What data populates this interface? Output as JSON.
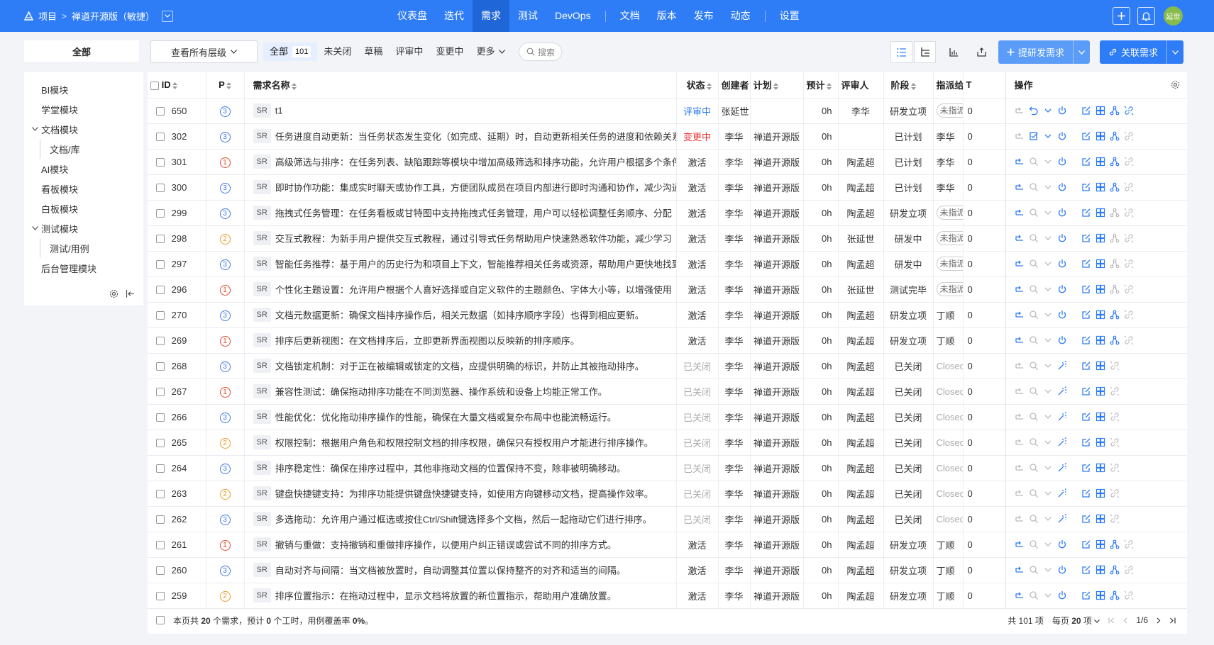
{
  "topbar": {
    "project_label": "项目",
    "project_name": "禅道开源版（敏捷）",
    "nav": [
      "仪表盘",
      "迭代",
      "需求",
      "测试",
      "DevOps",
      "文档",
      "版本",
      "发布",
      "动态",
      "设置"
    ],
    "active_nav": "需求",
    "avatar_text": "延世"
  },
  "filter": {
    "scope_all": "全部",
    "level_select": "查看所有层级",
    "tabs": [
      {
        "label": "全部",
        "count": "101",
        "active": true
      },
      {
        "label": "未关闭"
      },
      {
        "label": "草稿"
      },
      {
        "label": "评审中"
      },
      {
        "label": "变更中"
      },
      {
        "label": "更多"
      }
    ],
    "search_placeholder": "搜索",
    "btn_create": "提研发需求",
    "btn_link": "关联需求"
  },
  "sidebar": {
    "items": [
      {
        "label": "BI模块",
        "level": 0
      },
      {
        "label": "学堂模块",
        "level": 0
      },
      {
        "label": "文档模块",
        "level": 0,
        "expanded": true
      },
      {
        "label": "文档/库",
        "level": 1
      },
      {
        "label": "AI模块",
        "level": 0
      },
      {
        "label": "看板模块",
        "level": 0
      },
      {
        "label": "白板模块",
        "level": 0
      },
      {
        "label": "测试模块",
        "level": 0,
        "expanded": true
      },
      {
        "label": "测试/用例",
        "level": 1
      },
      {
        "label": "后台管理模块",
        "level": 0
      }
    ]
  },
  "table": {
    "columns": {
      "id": "ID",
      "pri": "P",
      "title": "需求名称",
      "status": "状态",
      "creator": "创建者",
      "plan": "计划",
      "estimate": "预计",
      "reviewer": "评审人",
      "stage": "阶段",
      "assigned": "指派给",
      "t": "T",
      "actions": "操作"
    },
    "rows": [
      {
        "id": "650",
        "pri": "3",
        "title": "t1",
        "status": "评审中",
        "status_type": "review",
        "creator": "张延世",
        "plan": "",
        "estimate": "0h",
        "reviewer": "李华",
        "stage": "研发立项",
        "assigned": "未指派",
        "assigned_type": "pill",
        "t": "0",
        "acts": "review"
      },
      {
        "id": "302",
        "pri": "3",
        "title": "任务进度自动更新：当任务状态发生变化（如完成、延期）时，自动更新相关任务的进度和依赖关系",
        "status": "变更中",
        "status_type": "change",
        "creator": "李华",
        "plan": "禅道开源版",
        "estimate": "0h",
        "reviewer": "",
        "stage": "已计划",
        "assigned": "李华",
        "assigned_type": "text",
        "t": "0",
        "acts": "change"
      },
      {
        "id": "301",
        "pri": "1",
        "title": "高级筛选与排序：在任务列表、缺陷跟踪等模块中增加高级筛选和排序功能，允许用户根据多个条件",
        "status": "激活",
        "status_type": "active",
        "creator": "李华",
        "plan": "禅道开源版",
        "estimate": "0h",
        "reviewer": "陶孟超",
        "stage": "已计划",
        "assigned": "李华",
        "assigned_type": "text",
        "t": "0",
        "acts": "active"
      },
      {
        "id": "300",
        "pri": "3",
        "title": "即时协作功能：集成实时聊天或协作工具，方便团队成员在项目内部进行即时沟通和协作，减少沟通",
        "status": "激活",
        "status_type": "active",
        "creator": "李华",
        "plan": "禅道开源版",
        "estimate": "0h",
        "reviewer": "陶孟超",
        "stage": "已计划",
        "assigned": "李华",
        "assigned_type": "text",
        "t": "0",
        "acts": "active"
      },
      {
        "id": "299",
        "pri": "3",
        "title": "拖拽式任务管理：在任务看板或甘特图中支持拖拽式任务管理，用户可以轻松调整任务顺序、分配",
        "status": "激活",
        "status_type": "active",
        "creator": "李华",
        "plan": "禅道开源版",
        "estimate": "0h",
        "reviewer": "陶孟超",
        "stage": "研发立项",
        "assigned": "未指派",
        "assigned_type": "pill",
        "t": "0",
        "acts": "active-dim"
      },
      {
        "id": "298",
        "pri": "2",
        "title": "交互式教程：为新手用户提供交互式教程，通过引导式任务帮助用户快速熟悉软件功能，减少学习",
        "status": "激活",
        "status_type": "active",
        "creator": "李华",
        "plan": "禅道开源版",
        "estimate": "0h",
        "reviewer": "张延世",
        "stage": "研发中",
        "assigned": "未指派",
        "assigned_type": "pill",
        "t": "0",
        "acts": "active-dim"
      },
      {
        "id": "297",
        "pri": "3",
        "title": "智能任务推荐：基于用户的历史行为和项目上下文，智能推荐相关任务或资源，帮助用户更快地找到",
        "status": "激活",
        "status_type": "active",
        "creator": "李华",
        "plan": "禅道开源版",
        "estimate": "0h",
        "reviewer": "陶孟超",
        "stage": "研发中",
        "assigned": "未指派",
        "assigned_type": "pill",
        "t": "0",
        "acts": "active-dim"
      },
      {
        "id": "296",
        "pri": "1",
        "title": "个性化主题设置：允许用户根据个人喜好选择或自定义软件的主题颜色、字体大小等，以增强使用",
        "status": "激活",
        "status_type": "active",
        "creator": "李华",
        "plan": "禅道开源版",
        "estimate": "0h",
        "reviewer": "张延世",
        "stage": "测试完毕",
        "assigned": "未指派",
        "assigned_type": "pill",
        "t": "0",
        "acts": "active-dim"
      },
      {
        "id": "270",
        "pri": "3",
        "title": "文档元数据更新：确保文档排序操作后，相关元数据（如排序顺序字段）也得到相应更新。",
        "status": "激活",
        "status_type": "active",
        "creator": "李华",
        "plan": "禅道开源版",
        "estimate": "0h",
        "reviewer": "陶孟超",
        "stage": "研发立项",
        "assigned": "丁顺",
        "assigned_type": "text",
        "t": "0",
        "acts": "active"
      },
      {
        "id": "269",
        "pri": "1",
        "title": "排序后更新视图：在文档排序后，立即更新界面视图以反映新的排序顺序。",
        "status": "激活",
        "status_type": "active",
        "creator": "李华",
        "plan": "禅道开源版",
        "estimate": "0h",
        "reviewer": "陶孟超",
        "stage": "研发立项",
        "assigned": "丁顺",
        "assigned_type": "text",
        "t": "0",
        "acts": "active"
      },
      {
        "id": "268",
        "pri": "3",
        "title": "文档锁定机制：对于正在被编辑或锁定的文档，应提供明确的标识，并防止其被拖动排序。",
        "status": "已关闭",
        "status_type": "closed",
        "creator": "李华",
        "plan": "禅道开源版",
        "estimate": "0h",
        "reviewer": "陶孟超",
        "stage": "已关闭",
        "assigned": "Closed",
        "assigned_type": "grey",
        "t": "0",
        "acts": "closed"
      },
      {
        "id": "267",
        "pri": "1",
        "title": "兼容性测试：确保拖动排序功能在不同浏览器、操作系统和设备上均能正常工作。",
        "status": "已关闭",
        "status_type": "closed",
        "creator": "李华",
        "plan": "禅道开源版",
        "estimate": "0h",
        "reviewer": "陶孟超",
        "stage": "已关闭",
        "assigned": "Closed",
        "assigned_type": "grey",
        "t": "0",
        "acts": "closed"
      },
      {
        "id": "266",
        "pri": "3",
        "title": "性能优化：优化拖动排序操作的性能，确保在大量文档或复杂布局中也能流畅运行。",
        "status": "已关闭",
        "status_type": "closed",
        "creator": "李华",
        "plan": "禅道开源版",
        "estimate": "0h",
        "reviewer": "陶孟超",
        "stage": "已关闭",
        "assigned": "Closed",
        "assigned_type": "grey",
        "t": "0",
        "acts": "closed"
      },
      {
        "id": "265",
        "pri": "2",
        "title": "权限控制：根据用户角色和权限控制文档的排序权限，确保只有授权用户才能进行排序操作。",
        "status": "已关闭",
        "status_type": "closed",
        "creator": "李华",
        "plan": "禅道开源版",
        "estimate": "0h",
        "reviewer": "陶孟超",
        "stage": "已关闭",
        "assigned": "Closed",
        "assigned_type": "grey",
        "t": "0",
        "acts": "closed"
      },
      {
        "id": "264",
        "pri": "3",
        "title": "排序稳定性：确保在排序过程中，其他非拖动文档的位置保持不变，除非被明确移动。",
        "status": "已关闭",
        "status_type": "closed",
        "creator": "李华",
        "plan": "禅道开源版",
        "estimate": "0h",
        "reviewer": "陶孟超",
        "stage": "已关闭",
        "assigned": "Closed",
        "assigned_type": "grey",
        "t": "0",
        "acts": "closed"
      },
      {
        "id": "263",
        "pri": "2",
        "title": "键盘快捷键支持：为排序功能提供键盘快捷键支持，如使用方向键移动文档，提高操作效率。",
        "status": "已关闭",
        "status_type": "closed",
        "creator": "李华",
        "plan": "禅道开源版",
        "estimate": "0h",
        "reviewer": "陶孟超",
        "stage": "已关闭",
        "assigned": "Closed",
        "assigned_type": "grey",
        "t": "0",
        "acts": "closed"
      },
      {
        "id": "262",
        "pri": "3",
        "title": "多选拖动：允许用户通过框选或按住Ctrl/Shift键选择多个文档，然后一起拖动它们进行排序。",
        "status": "已关闭",
        "status_type": "closed",
        "creator": "李华",
        "plan": "禅道开源版",
        "estimate": "0h",
        "reviewer": "陶孟超",
        "stage": "已关闭",
        "assigned": "Closed",
        "assigned_type": "grey",
        "t": "0",
        "acts": "closed"
      },
      {
        "id": "261",
        "pri": "1",
        "title": "撤销与重做：支持撤销和重做排序操作，以便用户纠正错误或尝试不同的排序方式。",
        "status": "激活",
        "status_type": "active",
        "creator": "李华",
        "plan": "禅道开源版",
        "estimate": "0h",
        "reviewer": "陶孟超",
        "stage": "研发立项",
        "assigned": "丁顺",
        "assigned_type": "text",
        "t": "0",
        "acts": "active"
      },
      {
        "id": "260",
        "pri": "3",
        "title": "自动对齐与间隔：当文档被放置时，自动调整其位置以保持整齐的对齐和适当的间隔。",
        "status": "激活",
        "status_type": "active",
        "creator": "李华",
        "plan": "禅道开源版",
        "estimate": "0h",
        "reviewer": "陶孟超",
        "stage": "研发立项",
        "assigned": "丁顺",
        "assigned_type": "text",
        "t": "0",
        "acts": "active"
      },
      {
        "id": "259",
        "pri": "2",
        "title": "排序位置指示：在拖动过程中，显示文档将放置的新位置指示，帮助用户准确放置。",
        "status": "激活",
        "status_type": "active",
        "creator": "李华",
        "plan": "禅道开源版",
        "estimate": "0h",
        "reviewer": "陶孟超",
        "stage": "研发立项",
        "assigned": "丁顺",
        "assigned_type": "text",
        "t": "0",
        "acts": "active"
      }
    ]
  },
  "footer": {
    "summary_pre": "本页共",
    "summary_count": "20",
    "summary_mid": "个需求，预计",
    "summary_hours": "0",
    "summary_post": "个工时，用例覆盖率",
    "summary_coverage": "0%",
    "summary_end": "。",
    "total": "共 101 项",
    "per_page_pre": "每页",
    "per_page": "20",
    "per_page_post": "项",
    "page": "1/6"
  },
  "colors": {
    "primary": "#2e7cf6",
    "light_primary": "#5b9cf8",
    "accent_active": "#1f66d9"
  }
}
